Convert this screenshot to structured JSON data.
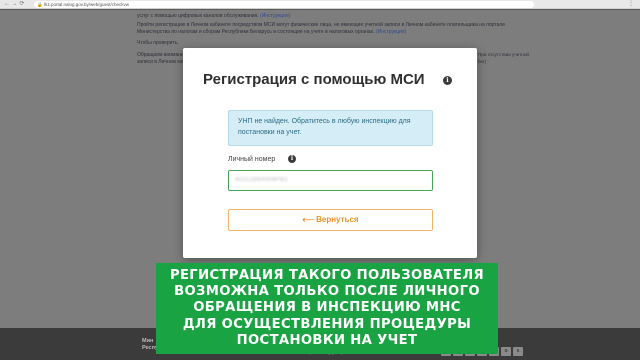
{
  "browser": {
    "nav": "←  →  ⟳",
    "url": "lk1.portal.nalog.gov.by/web/guest/checkvw",
    "menu": "⋮"
  },
  "background": {
    "line1_text": "услуг с помощью цифровых каналов обслуживания.",
    "line1_link": "(Инструкция)",
    "line2": "Пройти регистрацию в Личном кабинете посредством МСИ могут физические лица, не имеющие учетной записи в Личном кабинете плательщика на портале",
    "line3_text": "Министерства по налогам и сборам Республики Беларусь и состоящие на учете в налоговых органах.",
    "line3_link": "(Инструкция)",
    "line4": "Чтобы проверить,",
    "line5": "Обращаем внимание",
    "line6": "записи в Личном каб",
    "side1": "При отсутствии учетной",
    "side2": "ber)"
  },
  "footer": {
    "org_line1": "Мин",
    "org_line2": "Республика Беларусь",
    "mini": "www.portal.nalog.gov.by",
    "social": [
      "B",
      "Y",
      "f",
      "t",
      "v",
      "o",
      "s"
    ]
  },
  "modal": {
    "title": "Регистрация с помощью МСИ",
    "info_icon": "i",
    "alert": "УНП не найден. Обратитесь в любую инспекцию для постановки на учет.",
    "field_label": "Личный номер",
    "field_value": "4021286A004PB1",
    "back_button": "⟵  Вернуться"
  },
  "banner": {
    "text": "РЕГИСТРАЦИЯ ТАКОГО ПОЛЬЗОВАТЕЛЯ\nВОЗМОЖНА ТОЛЬКО ПОСЛЕ ЛИЧНОГО\nОБРАЩЕНИЯ В ИНСПЕКЦИЮ МНС\nДЛЯ ОСУЩЕСТВЛЕНИЯ ПРОЦЕДУРЫ\nПОСТАНОВКИ НА УЧЕТ"
  },
  "colors": {
    "banner": "#1aa342",
    "alert_bg": "#d4edf7",
    "field_border": "#4aa35a",
    "button_accent": "#e6932a"
  }
}
